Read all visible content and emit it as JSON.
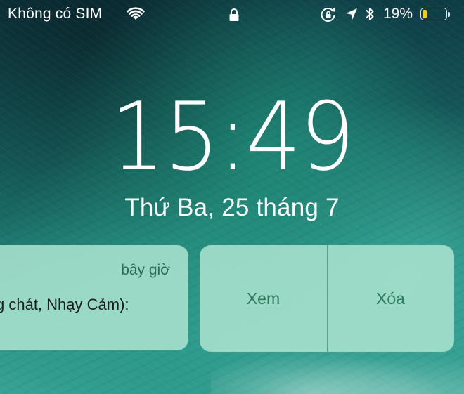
{
  "status_bar": {
    "carrier": "Không có SIM",
    "battery_percent_text": "19%",
    "battery_level": 0.19,
    "battery_color": "#ffcc00",
    "icons": [
      "wifi-icon",
      "lock-icon",
      "rotation-lock-icon",
      "location-arrow-icon",
      "bluetooth-icon",
      "battery-icon"
    ]
  },
  "lock_screen": {
    "time": "15:49",
    "date": "Thứ Ba, 25 tháng 7"
  },
  "notification": {
    "timestamp": "bây giờ",
    "body": "g chát, Nhạy Cảm):"
  },
  "actions": {
    "view_label": "Xem",
    "delete_label": "Xóa"
  },
  "colors": {
    "card_background": "#a8e2ce",
    "action_text": "#2f7a5c",
    "timestamp_text": "#2b6b55"
  }
}
